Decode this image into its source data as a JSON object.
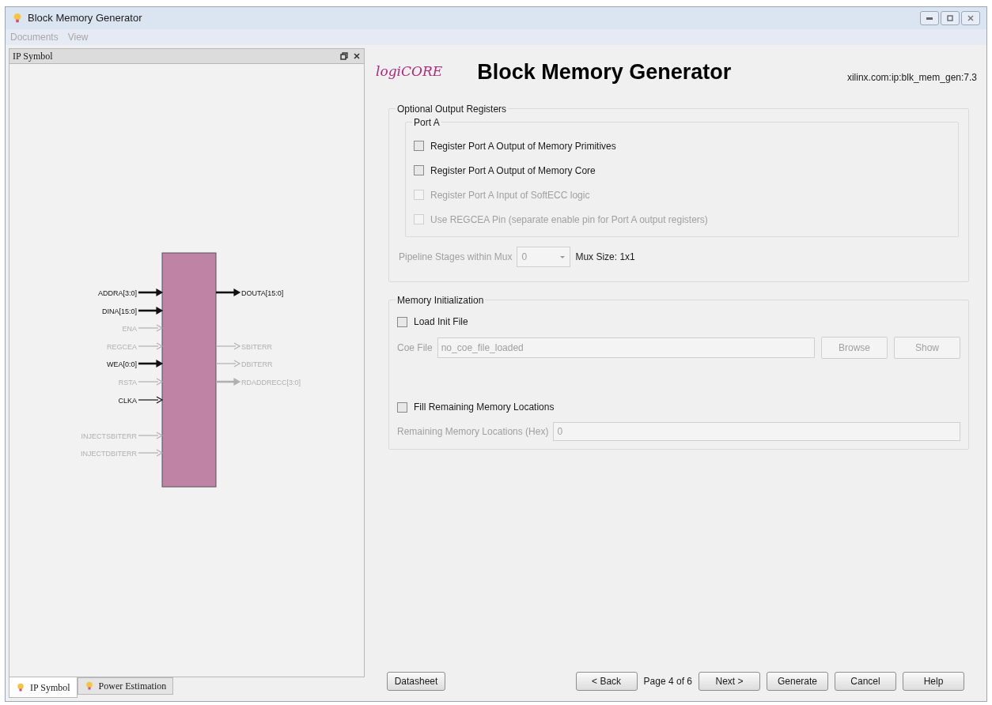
{
  "window": {
    "title": "Block Memory Generator"
  },
  "menu": [
    {
      "label": "Documents",
      "disabled": true
    },
    {
      "label": "View",
      "disabled": true
    }
  ],
  "left_panel": {
    "title": "IP Symbol",
    "input_pins": [
      {
        "label": "ADDRA[3:0]",
        "enabled": true,
        "bus": true
      },
      {
        "label": "DINA[15:0]",
        "enabled": true,
        "bus": true
      },
      {
        "label": "ENA",
        "enabled": false,
        "bus": false
      },
      {
        "label": "REGCEA",
        "enabled": false,
        "bus": false
      },
      {
        "label": "WEA[0:0]",
        "enabled": true,
        "bus": true
      },
      {
        "label": "RSTA",
        "enabled": false,
        "bus": false
      },
      {
        "label": "CLKA",
        "enabled": true,
        "bus": false
      },
      {
        "label": "INJECTSBITERR",
        "enabled": false,
        "bus": false
      },
      {
        "label": "INJECTDBITERR",
        "enabled": false,
        "bus": false
      }
    ],
    "output_pins": [
      {
        "label": "DOUTA[15:0]",
        "enabled": true,
        "bus": true
      },
      {
        "label": "SBITERR",
        "enabled": false,
        "bus": false
      },
      {
        "label": "DBITERR",
        "enabled": false,
        "bus": false
      },
      {
        "label": "RDADDRECC[3:0]",
        "enabled": false,
        "bus": true
      }
    ],
    "tabs": [
      {
        "label": "IP Symbol",
        "selected": true
      },
      {
        "label": "Power Estimation",
        "selected": false
      }
    ]
  },
  "header": {
    "logo": "logiCORE",
    "title": "Block Memory Generator",
    "ip_id": "xilinx.com:ip:blk_mem_gen:7.3"
  },
  "output_registers": {
    "title": "Optional Output Registers",
    "port_title": "Port A",
    "options": [
      {
        "label": "Register Port A Output of Memory Primitives",
        "checked": false,
        "disabled": false
      },
      {
        "label": "Register Port A Output of Memory Core",
        "checked": false,
        "disabled": false
      },
      {
        "label": "Register Port A Input of SoftECC logic",
        "checked": false,
        "disabled": true
      },
      {
        "label": "Use REGCEA Pin (separate enable pin for Port A output registers)",
        "checked": false,
        "disabled": true
      }
    ],
    "pipeline_label": "Pipeline Stages within Mux",
    "pipeline_value": "0",
    "mux_size": "Mux Size: 1x1"
  },
  "memory_init": {
    "title": "Memory Initialization",
    "load_init": {
      "label": "Load Init File",
      "checked": false
    },
    "coe_label": "Coe File",
    "coe_value": "no_coe_file_loaded",
    "browse": "Browse",
    "show": "Show",
    "fill": {
      "label": "Fill Remaining Memory Locations",
      "checked": false
    },
    "remaining_label": "Remaining Memory Locations (Hex)",
    "remaining_value": "0"
  },
  "buttons": {
    "datasheet": "Datasheet",
    "back": "< Back",
    "page": "Page 4 of 6",
    "nav": [
      "Next >",
      "Generate",
      "Cancel",
      "Help"
    ]
  }
}
